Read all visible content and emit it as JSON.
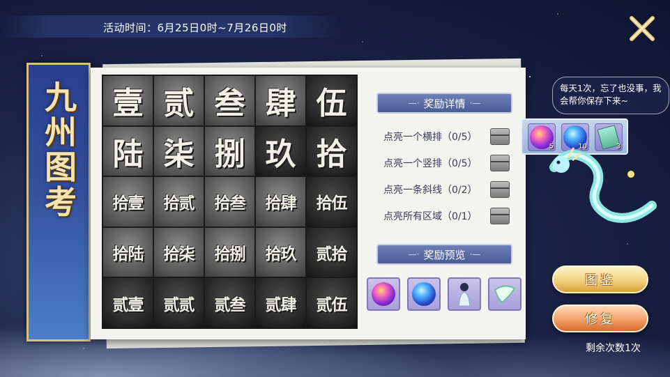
{
  "event_time": "活动时间：6月25日0时~7月26日0时",
  "banner_title": "九\n州\n图\n考",
  "grid": [
    {
      "text": "壹",
      "size": "big"
    },
    {
      "text": "贰",
      "size": "big"
    },
    {
      "text": "叁",
      "size": "big"
    },
    {
      "text": "肆",
      "size": "big"
    },
    {
      "text": "伍",
      "size": "big"
    },
    {
      "text": "陆",
      "size": "big"
    },
    {
      "text": "柒",
      "size": "big"
    },
    {
      "text": "捌",
      "size": "big"
    },
    {
      "text": "玖",
      "size": "big"
    },
    {
      "text": "拾",
      "size": "big"
    },
    {
      "text": "拾壹",
      "size": "small"
    },
    {
      "text": "拾贰",
      "size": "small"
    },
    {
      "text": "拾叁",
      "size": "small"
    },
    {
      "text": "拾肆",
      "size": "small"
    },
    {
      "text": "拾伍",
      "size": "small"
    },
    {
      "text": "拾陆",
      "size": "small"
    },
    {
      "text": "拾柒",
      "size": "small"
    },
    {
      "text": "拾捌",
      "size": "small"
    },
    {
      "text": "拾玖",
      "size": "small"
    },
    {
      "text": "贰拾",
      "size": "small"
    },
    {
      "text": "贰壹",
      "size": "small"
    },
    {
      "text": "贰贰",
      "size": "small"
    },
    {
      "text": "贰叁",
      "size": "small"
    },
    {
      "text": "贰肆",
      "size": "small"
    },
    {
      "text": "贰伍",
      "size": "small"
    }
  ],
  "reward_details": {
    "header": "奖励详情",
    "tasks": [
      "点亮一个横排（0/5）",
      "点亮一个竖排（0/5）",
      "点亮一条斜线（0/2）",
      "点亮所有区域（0/1）"
    ]
  },
  "reward_preview": {
    "header": "奖励预览",
    "items": [
      "purple-orb-icon",
      "blue-orb-icon",
      "character-icon",
      "wing-icon"
    ]
  },
  "helper": {
    "message": "每天1次，忘了也没事，我会帮你保存下来~",
    "stored_rewards": [
      {
        "icon": "purple-orb-icon",
        "count": "5"
      },
      {
        "icon": "blue-orb-icon",
        "count": "10"
      },
      {
        "icon": "ticket-icon",
        "count": "3"
      }
    ]
  },
  "buttons": {
    "catalog": "图鉴",
    "repair": "修复"
  },
  "remaining": "剩余次数1次",
  "colors": {
    "panel": "#f3f3ef",
    "banner": "#34509e",
    "section_header": "#5b6aa3",
    "gold_button": "#f2d27c",
    "orange_button": "#f4a06a"
  }
}
